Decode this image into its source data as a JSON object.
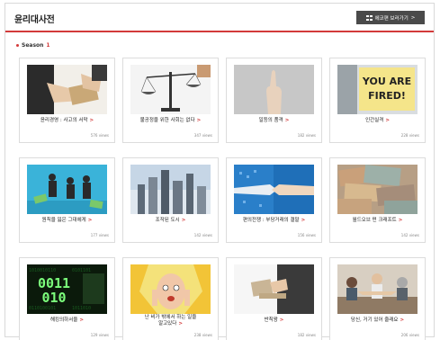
{
  "header": {
    "title": "윤리대사전",
    "all_button_label": "에코편 보러가기",
    "all_button_chevron": ">"
  },
  "season": {
    "label": "Season",
    "number": "1"
  },
  "cards": [
    {
      "title": "윤리경영 : 사고의 서막",
      "views": "576 views"
    },
    {
      "title": "불공정을 위한 사회는 없다",
      "views": "347 views"
    },
    {
      "title": "일등의 품격",
      "views": "182 views"
    },
    {
      "title": "인간실격",
      "views": "228 views"
    },
    {
      "title": "원칙을 잃은 그대에게",
      "views": "177 views"
    },
    {
      "title": "조작된 도시",
      "views": "142 views"
    },
    {
      "title": "편의전쟁 : 부당거래의 결말",
      "views": "156 views"
    },
    {
      "title": "월드오브 펀 크래프트",
      "views": "142 views"
    },
    {
      "title": "해킹의하서울",
      "views": "129 views"
    },
    {
      "title": "난 비가 밖에서 하는 일을\n알고있다",
      "views": "238 views"
    },
    {
      "title": "반칙왕",
      "views": "182 views"
    },
    {
      "title": "당신, 거기 있어 줄래요",
      "views": "206 views"
    }
  ],
  "thumb_text": {
    "fired": "YOU ARE FIRED!",
    "binary": "0011 010"
  },
  "colors": {
    "accent": "#d33a3a",
    "button_bg": "#4a4a4a"
  }
}
